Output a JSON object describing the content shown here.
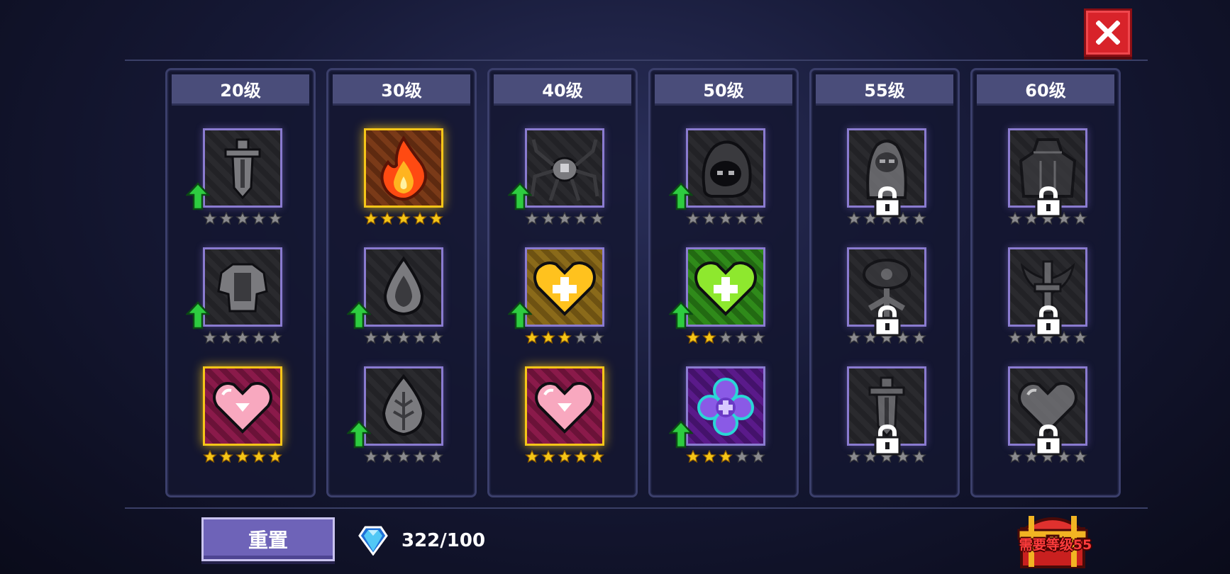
{
  "window": {
    "close_label": "×"
  },
  "columns": [
    {
      "level_label": "20级",
      "slots": [
        {
          "icon": "sword-icon",
          "rank": 0,
          "max_rank": 5,
          "upgradable": true,
          "locked": false,
          "maxed": false
        },
        {
          "icon": "armor-icon",
          "rank": 0,
          "max_rank": 5,
          "upgradable": true,
          "locked": false,
          "maxed": false
        },
        {
          "icon": "pink-heart-icon",
          "rank": 5,
          "max_rank": 5,
          "upgradable": false,
          "locked": false,
          "maxed": true
        }
      ]
    },
    {
      "level_label": "30级",
      "slots": [
        {
          "icon": "fire-icon",
          "rank": 5,
          "max_rank": 5,
          "upgradable": false,
          "locked": false,
          "maxed": true
        },
        {
          "icon": "drop-icon",
          "rank": 0,
          "max_rank": 5,
          "upgradable": true,
          "locked": false,
          "maxed": false
        },
        {
          "icon": "leaf-drop-icon",
          "rank": 0,
          "max_rank": 5,
          "upgradable": true,
          "locked": false,
          "maxed": false
        }
      ]
    },
    {
      "level_label": "40级",
      "slots": [
        {
          "icon": "spider-icon",
          "rank": 0,
          "max_rank": 5,
          "upgradable": true,
          "locked": false,
          "maxed": false
        },
        {
          "icon": "gold-heart-plus-icon",
          "rank": 3,
          "max_rank": 5,
          "upgradable": true,
          "locked": false,
          "maxed": false
        },
        {
          "icon": "pink-heart-icon",
          "rank": 5,
          "max_rank": 5,
          "upgradable": false,
          "locked": false,
          "maxed": true
        }
      ]
    },
    {
      "level_label": "50级",
      "slots": [
        {
          "icon": "hooded-ghost-icon",
          "rank": 0,
          "max_rank": 5,
          "upgradable": true,
          "locked": false,
          "maxed": false
        },
        {
          "icon": "green-heart-plus-icon",
          "rank": 2,
          "max_rank": 5,
          "upgradable": true,
          "locked": false,
          "maxed": false
        },
        {
          "icon": "purple-clover-icon",
          "rank": 3,
          "max_rank": 5,
          "upgradable": true,
          "locked": false,
          "maxed": false
        }
      ]
    },
    {
      "level_label": "55级",
      "slots": [
        {
          "icon": "hooded-figure-icon",
          "rank": 0,
          "max_rank": 5,
          "upgradable": false,
          "locked": true,
          "maxed": false
        },
        {
          "icon": "helmet-tree-icon",
          "rank": 0,
          "max_rank": 5,
          "upgradable": false,
          "locked": true,
          "maxed": false
        },
        {
          "icon": "sword-icon",
          "rank": 0,
          "max_rank": 5,
          "upgradable": false,
          "locked": true,
          "maxed": false
        }
      ]
    },
    {
      "level_label": "60级",
      "slots": [
        {
          "icon": "cloak-icon",
          "rank": 0,
          "max_rank": 5,
          "upgradable": false,
          "locked": true,
          "maxed": false
        },
        {
          "icon": "winged-sword-icon",
          "rank": 0,
          "max_rank": 5,
          "upgradable": false,
          "locked": true,
          "maxed": false
        },
        {
          "icon": "heart-icon",
          "rank": 0,
          "max_rank": 5,
          "upgradable": false,
          "locked": true,
          "maxed": false
        }
      ]
    }
  ],
  "footer": {
    "reset_label": "重置",
    "points_text": "322/100",
    "chest_label": "需要等级55"
  },
  "colors": {
    "star_filled": "#f5c518",
    "star_empty": "#8a8a8e",
    "upgrade_arrow": "#2ecc40",
    "slot_border": "#8a7bd0",
    "slot_border_maxed": "#f5c518",
    "close_button": "#d8232a",
    "reset_button": "#6e63b8",
    "chest_label": "#ff3d3d"
  }
}
